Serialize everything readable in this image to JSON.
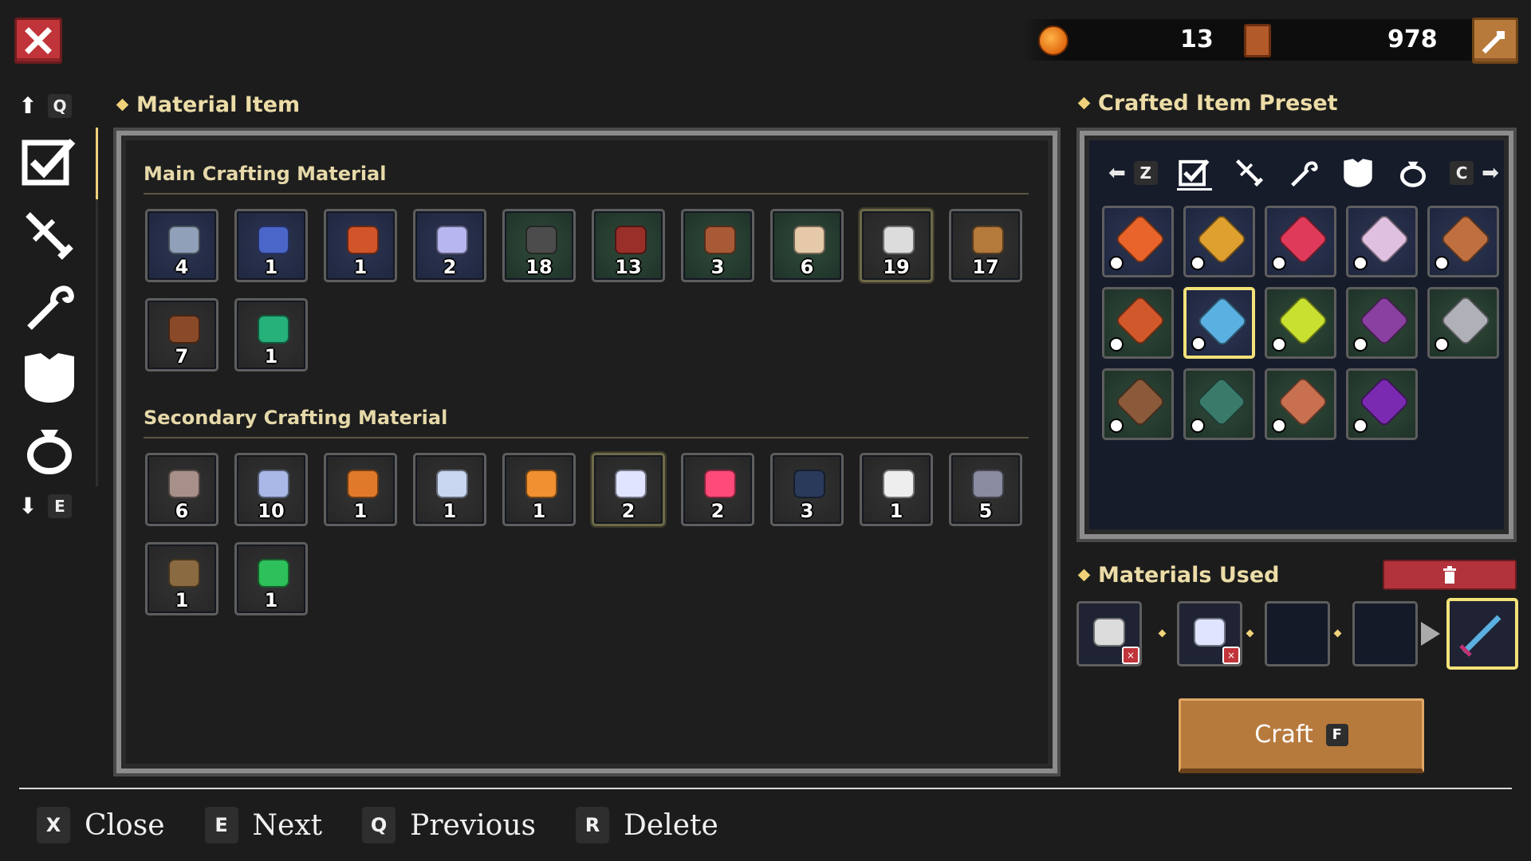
{
  "header": {
    "close_icon": "close-x-icon",
    "currencies": [
      {
        "icon": "gold-coin-icon",
        "value": "13"
      },
      {
        "icon": "scroll-token-icon",
        "value": "978"
      }
    ],
    "settings_icon": "wrench-icon"
  },
  "sidebar": {
    "up_key": "Q",
    "down_key": "E",
    "categories": [
      {
        "icon": "checkmark-all-icon",
        "active": true
      },
      {
        "icon": "sword-icon"
      },
      {
        "icon": "staff-icon"
      },
      {
        "icon": "armor-icon"
      },
      {
        "icon": "ring-icon"
      }
    ]
  },
  "material_panel": {
    "title": "Material Item",
    "main_title": "Main Crafting Material",
    "secondary_title": "Secondary Crafting Material",
    "main_items": [
      {
        "icon": "iron-ore-icon",
        "count": "4",
        "color": "#8fa0b8",
        "bg": "blue"
      },
      {
        "icon": "blue-cloth-icon",
        "count": "1",
        "color": "#4a66c8",
        "bg": "blue"
      },
      {
        "icon": "orange-leather-icon",
        "count": "1",
        "color": "#d2552a",
        "bg": "blue"
      },
      {
        "icon": "diamond-icon",
        "count": "2",
        "color": "#b8b6f0",
        "bg": "blue"
      },
      {
        "icon": "coal-ore-icon",
        "count": "18",
        "color": "#4c4c4c",
        "bg": "green"
      },
      {
        "icon": "red-leather-roll-icon",
        "count": "13",
        "color": "#9a2f2a",
        "bg": "green"
      },
      {
        "icon": "spider-hide-icon",
        "count": "3",
        "color": "#a85a36",
        "bg": "green"
      },
      {
        "icon": "pearl-icon",
        "count": "6",
        "color": "#e6c9a8",
        "bg": "green"
      },
      {
        "icon": "silver-ore-icon",
        "count": "19",
        "color": "#dcdcdc",
        "bg": "dark",
        "selected": true
      },
      {
        "icon": "wood-log-icon",
        "count": "17",
        "color": "#b37a3c",
        "bg": "dark"
      },
      {
        "icon": "brown-hide-icon",
        "count": "7",
        "color": "#8a4a2a",
        "bg": "dark"
      },
      {
        "icon": "emerald-icon",
        "count": "1",
        "color": "#26b07a",
        "bg": "dark"
      }
    ],
    "secondary_items": [
      {
        "icon": "feather-tuft-icon",
        "count": "6",
        "color": "#a8908a",
        "bg": "dark"
      },
      {
        "icon": "crystal-shard-icon",
        "count": "10",
        "color": "#a9b8e6",
        "bg": "dark"
      },
      {
        "icon": "hourglass-icon",
        "count": "1",
        "color": "#e07a2a",
        "bg": "dark"
      },
      {
        "icon": "magnifier-icon",
        "count": "1",
        "color": "#c9d6f0",
        "bg": "dark"
      },
      {
        "icon": "ankh-icon",
        "count": "1",
        "color": "#f09030",
        "bg": "dark"
      },
      {
        "icon": "prism-crystal-icon",
        "count": "2",
        "color": "#e0e4ff",
        "bg": "dark",
        "selected": true
      },
      {
        "icon": "pink-gem-icon",
        "count": "2",
        "color": "#ff4a7a",
        "bg": "dark"
      },
      {
        "icon": "dark-amulet-icon",
        "count": "3",
        "color": "#2a3a5a",
        "bg": "dark"
      },
      {
        "icon": "white-feather-icon",
        "count": "1",
        "color": "#eeeeee",
        "bg": "dark"
      },
      {
        "icon": "scroll-page-icon",
        "count": "5",
        "color": "#8a8aa0",
        "bg": "dark"
      },
      {
        "icon": "potion-sack-icon",
        "count": "1",
        "color": "#8a6a40",
        "bg": "dark"
      },
      {
        "icon": "green-crystal-icon",
        "count": "1",
        "color": "#2ec05a",
        "bg": "dark"
      }
    ]
  },
  "preset_panel": {
    "title": "Crafted Item Preset",
    "left_key": "Z",
    "right_key": "C",
    "tabs": [
      {
        "icon": "checkmark-all-icon",
        "active": true
      },
      {
        "icon": "sword-icon"
      },
      {
        "icon": "staff-icon"
      },
      {
        "icon": "armor-icon"
      },
      {
        "icon": "ring-icon"
      }
    ],
    "items": [
      {
        "icon": "flame-sword-icon",
        "color": "#e8642a",
        "bg": "blue"
      },
      {
        "icon": "golden-mace-icon",
        "color": "#e0a030",
        "bg": "blue"
      },
      {
        "icon": "crimson-dagger-icon",
        "color": "#e03a5a",
        "bg": "blue"
      },
      {
        "icon": "crystal-scepter-icon",
        "color": "#e0c0e0",
        "bg": "blue"
      },
      {
        "icon": "bow-icon",
        "color": "#c07040",
        "bg": "blue"
      },
      {
        "icon": "war-axe-icon",
        "color": "#d0582a",
        "bg": "green"
      },
      {
        "icon": "ice-sword-icon",
        "color": "#5ab0e0",
        "bg": "blue",
        "selected": true
      },
      {
        "icon": "lantern-staff-icon",
        "color": "#c8e030",
        "bg": "green"
      },
      {
        "icon": "dark-wand-icon",
        "color": "#8a40a0",
        "bg": "green"
      },
      {
        "icon": "chainmail-icon",
        "color": "#b0b0b8",
        "bg": "green"
      },
      {
        "icon": "leather-gauntlet-icon",
        "color": "#8a5a3a",
        "bg": "green"
      },
      {
        "icon": "green-helmet-icon",
        "color": "#3a7a6a",
        "bg": "green"
      },
      {
        "icon": "rope-whip-icon",
        "color": "#c87050",
        "bg": "green"
      },
      {
        "icon": "void-amulet-icon",
        "color": "#7a2ab0",
        "bg": "green"
      }
    ]
  },
  "materials_used": {
    "title": "Materials Used",
    "delete_icon": "trash-icon",
    "slots": [
      {
        "icon": "silver-ore-icon",
        "color": "#dcdcdc",
        "removable": true
      },
      {
        "icon": "prism-crystal-icon",
        "color": "#e0e4ff",
        "removable": true
      },
      {
        "icon": "",
        "empty": true
      },
      {
        "icon": "",
        "empty": true
      }
    ],
    "result": {
      "icon": "ice-sword-icon",
      "color": "#5ab0e0"
    },
    "remove_label": "×"
  },
  "craft_button": {
    "label": "Craft",
    "key": "F"
  },
  "hints": [
    {
      "key": "X",
      "label": "Close"
    },
    {
      "key": "E",
      "label": "Next"
    },
    {
      "key": "Q",
      "label": "Previous"
    },
    {
      "key": "R",
      "label": "Delete"
    }
  ]
}
